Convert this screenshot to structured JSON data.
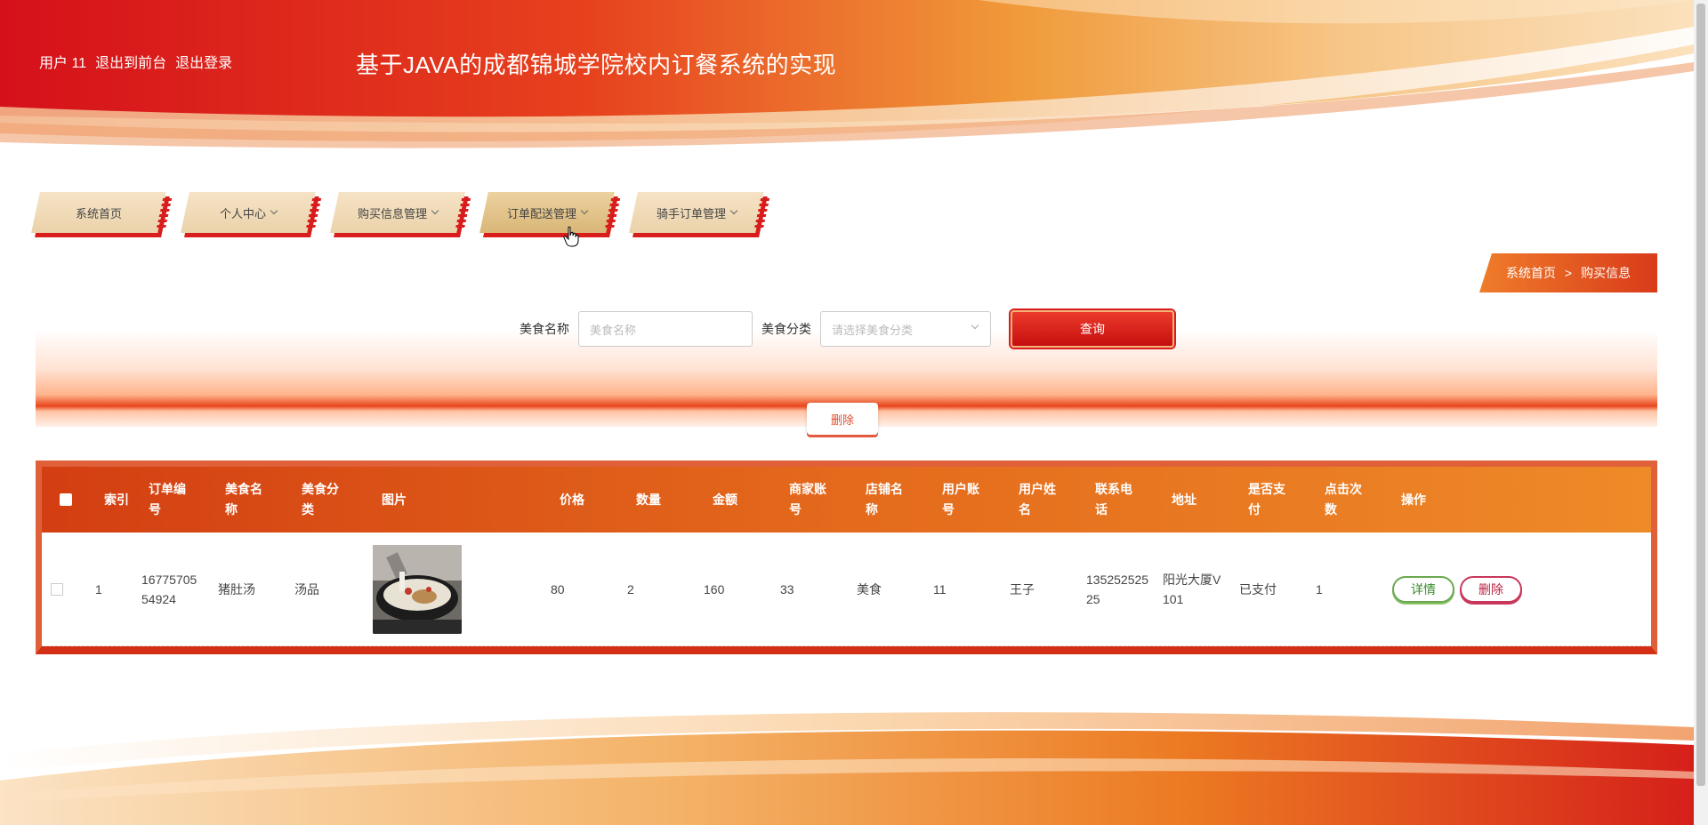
{
  "header": {
    "user_label": "用户 11",
    "to_frontend": "退出到前台",
    "logout": "退出登录",
    "title": "基于JAVA的成都锦城学院校内订餐系统的实现"
  },
  "nav": {
    "items": [
      {
        "label": "系统首页",
        "has_dropdown": false
      },
      {
        "label": "个人中心",
        "has_dropdown": true
      },
      {
        "label": "购买信息管理",
        "has_dropdown": true
      },
      {
        "label": "订单配送管理",
        "has_dropdown": true,
        "active": true
      },
      {
        "label": "骑手订单管理",
        "has_dropdown": true
      }
    ]
  },
  "breadcrumb": {
    "home": "系统首页",
    "separator": ">",
    "current": "购买信息"
  },
  "search": {
    "food_name_label": "美食名称",
    "food_name_placeholder": "美食名称",
    "food_category_label": "美食分类",
    "food_category_placeholder": "请选择美食分类",
    "query_button": "查询"
  },
  "toolbar": {
    "delete_label": "删除"
  },
  "table": {
    "headers": [
      {
        "key": "index",
        "label": "索引"
      },
      {
        "key": "order_no",
        "label": "订单编号"
      },
      {
        "key": "food_name",
        "label": "美食名称"
      },
      {
        "key": "food_category",
        "label": "美食分类"
      },
      {
        "key": "image",
        "label": "图片"
      },
      {
        "key": "price",
        "label": "价格"
      },
      {
        "key": "quantity",
        "label": "数量"
      },
      {
        "key": "amount",
        "label": "金额"
      },
      {
        "key": "merchant_account",
        "label": "商家账号"
      },
      {
        "key": "shop_name",
        "label": "店铺名称"
      },
      {
        "key": "user_account",
        "label": "用户账号"
      },
      {
        "key": "user_name",
        "label": "用户姓名"
      },
      {
        "key": "phone",
        "label": "联系电话"
      },
      {
        "key": "address",
        "label": "地址"
      },
      {
        "key": "is_paid",
        "label": "是否支付"
      },
      {
        "key": "clicks",
        "label": "点击次数"
      },
      {
        "key": "actions",
        "label": "操作"
      }
    ],
    "rows": [
      {
        "index": "1",
        "order_no": "1677570554924",
        "food_name": "猪肚汤",
        "food_category": "汤品",
        "price": "80",
        "quantity": "2",
        "amount": "160",
        "merchant_account": "33",
        "shop_name": "美食",
        "user_account": "11",
        "user_name": "王子",
        "phone": "13525252525",
        "address": "阳光大厦V101",
        "is_paid": "已支付",
        "clicks": "1",
        "detail_label": "详情",
        "delete_label": "删除"
      }
    ]
  },
  "colors": {
    "primary_red": "#d91c1c",
    "accent_orange": "#ee8a28",
    "nav_gold": "#ead2aa"
  }
}
